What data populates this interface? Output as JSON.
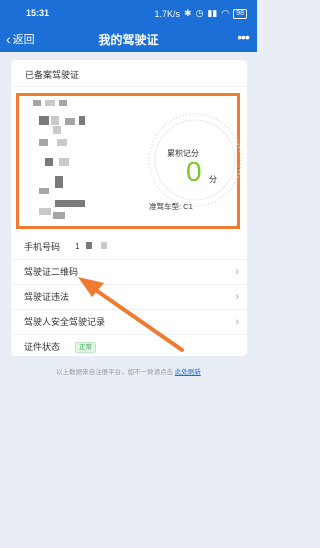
{
  "status_bar": {
    "time": "15:31",
    "net_speed": "1.7K/s",
    "battery": "98"
  },
  "nav": {
    "back_label": "返回",
    "title": "我的驾驶证",
    "more_label": "•••"
  },
  "card": {
    "title": "已备案驾驶证",
    "gauge_label": "累积记分",
    "score": "0",
    "score_unit": "分",
    "vehicle_type_label": "准驾车型: C1"
  },
  "rows": {
    "phone_label": "手机号码",
    "phone_value": "1",
    "qr_label": "驾驶证二维码",
    "violation_label": "驾驶证违法",
    "safety_label": "驾驶人安全驾驶记录",
    "status_label": "证件状态",
    "status_value": "正常"
  },
  "footer": {
    "text": "以上数据来自注册平台，如不一致请点击",
    "link": "此处刷新"
  },
  "colors": {
    "brand": "#1d6fd8",
    "highlight": "#f07a2f",
    "score": "#7cc62a"
  }
}
